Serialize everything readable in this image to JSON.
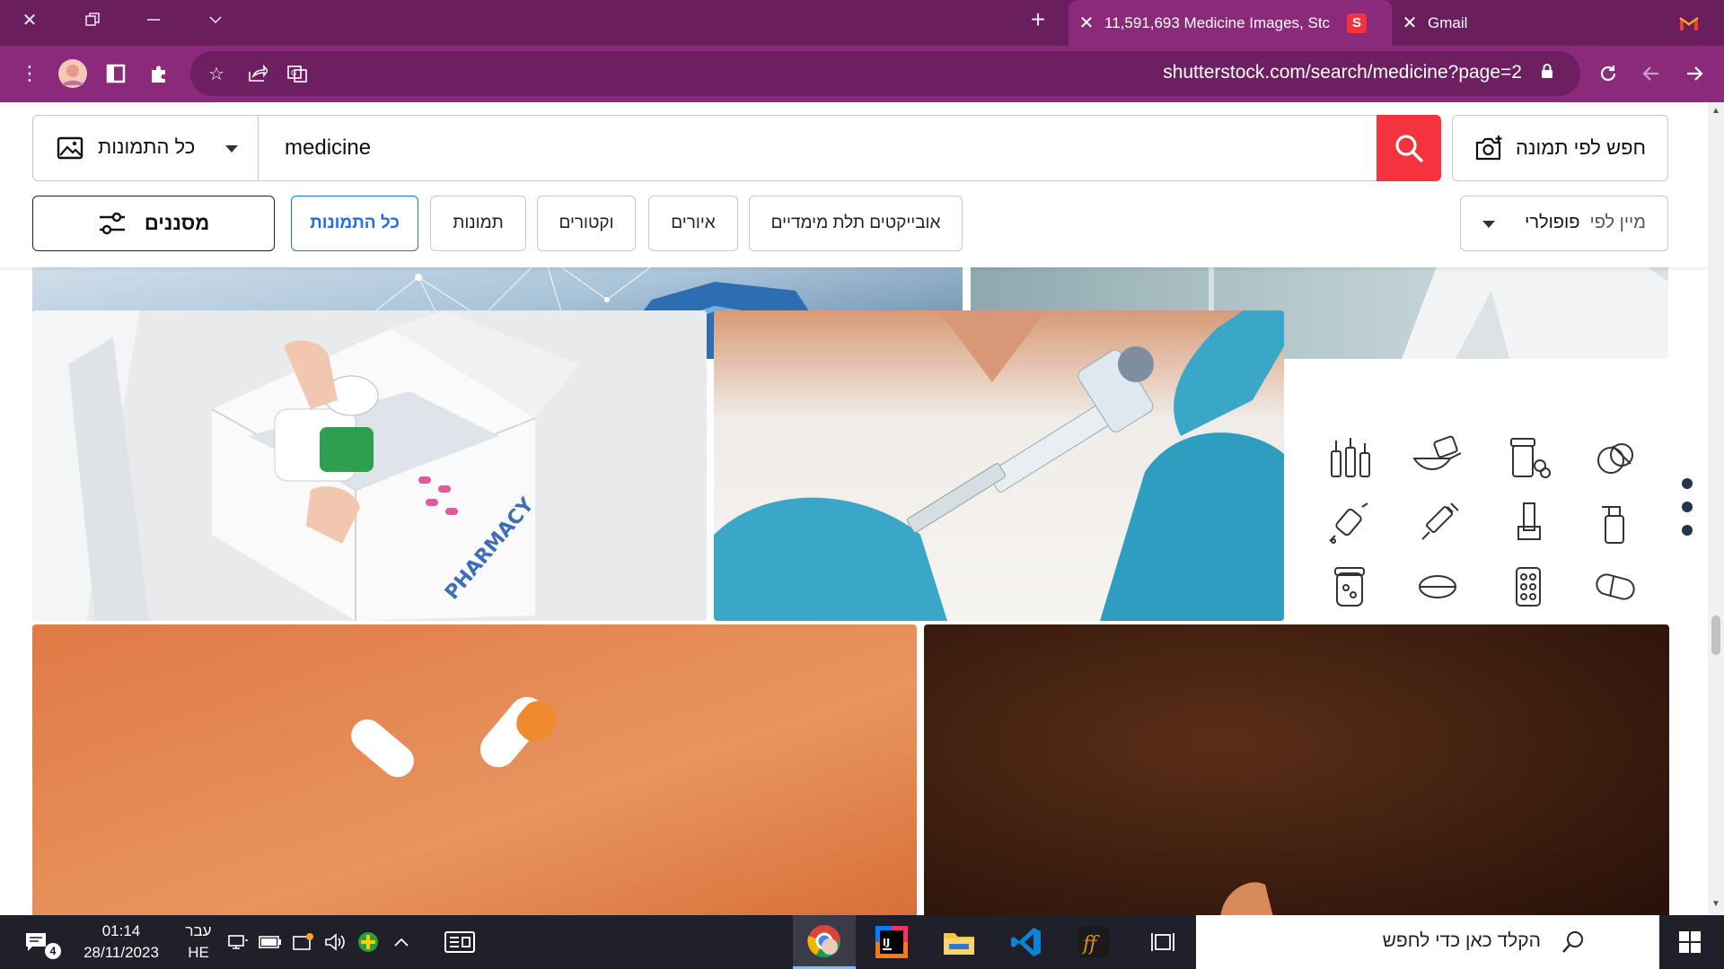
{
  "window": {
    "tabs": [
      {
        "title": "11,591,693 Medicine Images, Stc",
        "active": true
      },
      {
        "title": "Gmail",
        "active": false
      }
    ],
    "new_tab_label": "+"
  },
  "toolbar": {
    "url": "shutterstock.com/search/medicine?page=2"
  },
  "search": {
    "type_label": "כל התמונות",
    "query": "medicine",
    "image_search_label": "חפש לפי תמונה"
  },
  "filters": {
    "filters_button": "מסננים",
    "chips": [
      "כל התמונות",
      "תמונות",
      "וקטורים",
      "איורים",
      "אובייקטים תלת מימדיים"
    ],
    "active_chip": "כל התמונות",
    "sort_prefix": "מיין לפי",
    "sort_value": "פופולרי"
  },
  "taskbar": {
    "time": "01:14",
    "date": "28/11/2023",
    "lang_top": "עבר",
    "lang_bottom": "HE",
    "notification_count": "4",
    "search_placeholder": "הקלד כאן כדי לחפש"
  },
  "colors": {
    "tab_strip": "#6b1e5e",
    "toolbar": "#8b2a7a",
    "search_button": "#f5333f",
    "active_chip": "#1d6ee8"
  }
}
